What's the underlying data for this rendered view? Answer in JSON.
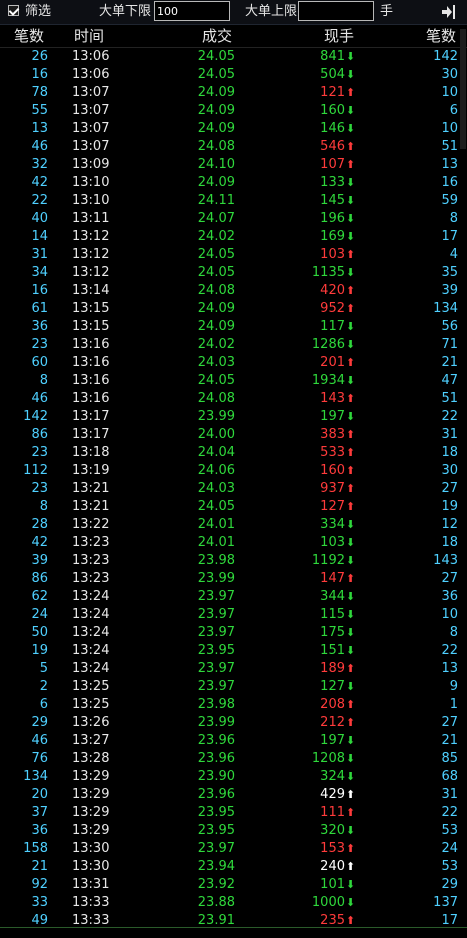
{
  "toolbar": {
    "filter_label": "筛选",
    "lower_label": "大单下限",
    "lower_value": "100",
    "upper_label": "大单上限",
    "upper_value": "",
    "unit_label": "手",
    "collapse_icon": "collapse-right-icon"
  },
  "columns": {
    "count": "笔数",
    "time": "时间",
    "price": "成交",
    "volume": "现手",
    "count2": "笔数"
  },
  "colors": {
    "buy": "#ff3b3b",
    "sell": "#2fd83c",
    "neutral": "#ffffff",
    "count": "#4fd0ff"
  },
  "rows": [
    {
      "count": "26",
      "time": "13:06",
      "price": "24.05",
      "volume": "841",
      "dir": "sell",
      "count2": "142"
    },
    {
      "count": "16",
      "time": "13:06",
      "price": "24.05",
      "volume": "504",
      "dir": "sell",
      "count2": "30"
    },
    {
      "count": "78",
      "time": "13:07",
      "price": "24.09",
      "volume": "121",
      "dir": "buy",
      "count2": "10"
    },
    {
      "count": "55",
      "time": "13:07",
      "price": "24.09",
      "volume": "160",
      "dir": "sell",
      "count2": "6"
    },
    {
      "count": "13",
      "time": "13:07",
      "price": "24.09",
      "volume": "146",
      "dir": "sell",
      "count2": "10"
    },
    {
      "count": "46",
      "time": "13:07",
      "price": "24.08",
      "volume": "546",
      "dir": "buy",
      "count2": "51"
    },
    {
      "count": "32",
      "time": "13:09",
      "price": "24.10",
      "volume": "107",
      "dir": "buy",
      "count2": "13"
    },
    {
      "count": "42",
      "time": "13:10",
      "price": "24.09",
      "volume": "133",
      "dir": "sell",
      "count2": "16"
    },
    {
      "count": "22",
      "time": "13:10",
      "price": "24.11",
      "volume": "145",
      "dir": "sell",
      "count2": "59"
    },
    {
      "count": "40",
      "time": "13:11",
      "price": "24.07",
      "volume": "196",
      "dir": "sell",
      "count2": "8"
    },
    {
      "count": "14",
      "time": "13:12",
      "price": "24.02",
      "volume": "169",
      "dir": "sell",
      "count2": "17"
    },
    {
      "count": "31",
      "time": "13:12",
      "price": "24.05",
      "volume": "103",
      "dir": "buy",
      "count2": "4"
    },
    {
      "count": "34",
      "time": "13:12",
      "price": "24.05",
      "volume": "1135",
      "dir": "sell",
      "count2": "35"
    },
    {
      "count": "16",
      "time": "13:14",
      "price": "24.08",
      "volume": "420",
      "dir": "buy",
      "count2": "39"
    },
    {
      "count": "61",
      "time": "13:15",
      "price": "24.09",
      "volume": "952",
      "dir": "buy",
      "count2": "134"
    },
    {
      "count": "36",
      "time": "13:15",
      "price": "24.09",
      "volume": "117",
      "dir": "sell",
      "count2": "56"
    },
    {
      "count": "23",
      "time": "13:16",
      "price": "24.02",
      "volume": "1286",
      "dir": "sell",
      "count2": "71"
    },
    {
      "count": "60",
      "time": "13:16",
      "price": "24.03",
      "volume": "201",
      "dir": "buy",
      "count2": "21"
    },
    {
      "count": "8",
      "time": "13:16",
      "price": "24.05",
      "volume": "1934",
      "dir": "sell",
      "count2": "47"
    },
    {
      "count": "46",
      "time": "13:16",
      "price": "24.08",
      "volume": "143",
      "dir": "buy",
      "count2": "51"
    },
    {
      "count": "142",
      "time": "13:17",
      "price": "23.99",
      "volume": "197",
      "dir": "sell",
      "count2": "22"
    },
    {
      "count": "86",
      "time": "13:17",
      "price": "24.00",
      "volume": "383",
      "dir": "buy",
      "count2": "31"
    },
    {
      "count": "23",
      "time": "13:18",
      "price": "24.04",
      "volume": "533",
      "dir": "buy",
      "count2": "18"
    },
    {
      "count": "112",
      "time": "13:19",
      "price": "24.06",
      "volume": "160",
      "dir": "buy",
      "count2": "30"
    },
    {
      "count": "23",
      "time": "13:21",
      "price": "24.03",
      "volume": "937",
      "dir": "buy",
      "count2": "27"
    },
    {
      "count": "8",
      "time": "13:21",
      "price": "24.05",
      "volume": "127",
      "dir": "buy",
      "count2": "19"
    },
    {
      "count": "28",
      "time": "13:22",
      "price": "24.01",
      "volume": "334",
      "dir": "sell",
      "count2": "12"
    },
    {
      "count": "42",
      "time": "13:23",
      "price": "24.01",
      "volume": "103",
      "dir": "sell",
      "count2": "18"
    },
    {
      "count": "39",
      "time": "13:23",
      "price": "23.98",
      "volume": "1192",
      "dir": "sell",
      "count2": "143"
    },
    {
      "count": "86",
      "time": "13:23",
      "price": "23.99",
      "volume": "147",
      "dir": "buy",
      "count2": "27"
    },
    {
      "count": "62",
      "time": "13:24",
      "price": "23.97",
      "volume": "344",
      "dir": "sell",
      "count2": "36"
    },
    {
      "count": "24",
      "time": "13:24",
      "price": "23.97",
      "volume": "115",
      "dir": "sell",
      "count2": "10"
    },
    {
      "count": "50",
      "time": "13:24",
      "price": "23.97",
      "volume": "175",
      "dir": "sell",
      "count2": "8"
    },
    {
      "count": "19",
      "time": "13:24",
      "price": "23.95",
      "volume": "151",
      "dir": "sell",
      "count2": "22"
    },
    {
      "count": "5",
      "time": "13:24",
      "price": "23.97",
      "volume": "189",
      "dir": "buy",
      "count2": "13"
    },
    {
      "count": "2",
      "time": "13:25",
      "price": "23.97",
      "volume": "127",
      "dir": "sell",
      "count2": "9"
    },
    {
      "count": "6",
      "time": "13:25",
      "price": "23.98",
      "volume": "208",
      "dir": "buy",
      "count2": "1"
    },
    {
      "count": "29",
      "time": "13:26",
      "price": "23.99",
      "volume": "212",
      "dir": "buy",
      "count2": "27"
    },
    {
      "count": "46",
      "time": "13:27",
      "price": "23.96",
      "volume": "197",
      "dir": "sell",
      "count2": "21"
    },
    {
      "count": "76",
      "time": "13:28",
      "price": "23.96",
      "volume": "1208",
      "dir": "sell",
      "count2": "85"
    },
    {
      "count": "134",
      "time": "13:29",
      "price": "23.90",
      "volume": "324",
      "dir": "sell",
      "count2": "68"
    },
    {
      "count": "20",
      "time": "13:29",
      "price": "23.96",
      "volume": "429",
      "dir": "neutral",
      "count2": "31"
    },
    {
      "count": "37",
      "time": "13:29",
      "price": "23.95",
      "volume": "111",
      "dir": "buy",
      "count2": "22"
    },
    {
      "count": "36",
      "time": "13:29",
      "price": "23.95",
      "volume": "320",
      "dir": "sell",
      "count2": "53"
    },
    {
      "count": "158",
      "time": "13:30",
      "price": "23.97",
      "volume": "153",
      "dir": "buy",
      "count2": "24"
    },
    {
      "count": "21",
      "time": "13:30",
      "price": "23.94",
      "volume": "240",
      "dir": "neutral",
      "count2": "53"
    },
    {
      "count": "92",
      "time": "13:31",
      "price": "23.92",
      "volume": "101",
      "dir": "sell",
      "count2": "29"
    },
    {
      "count": "33",
      "time": "13:33",
      "price": "23.88",
      "volume": "1000",
      "dir": "sell",
      "count2": "137"
    },
    {
      "count": "49",
      "time": "13:33",
      "price": "23.91",
      "volume": "235",
      "dir": "buy",
      "count2": "17"
    }
  ]
}
